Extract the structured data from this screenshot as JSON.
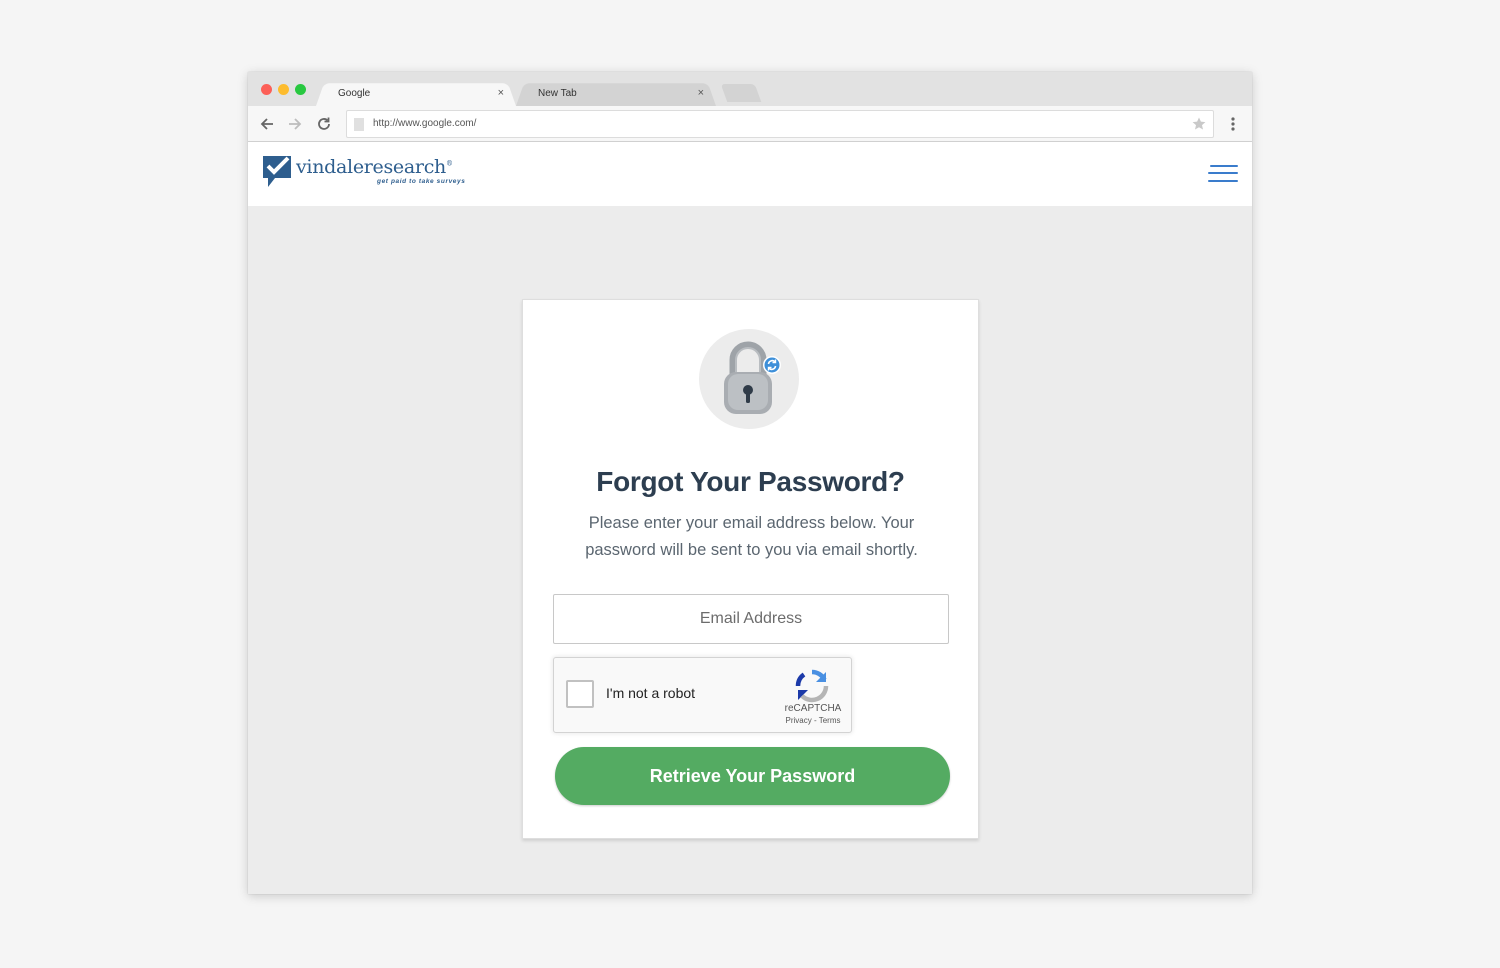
{
  "browser": {
    "tabs": [
      {
        "label": "Google",
        "close": "×"
      },
      {
        "label": "New Tab",
        "close": "×"
      }
    ],
    "url": "http://www.google.com/"
  },
  "site": {
    "logo_name": "vindaleresearch",
    "logo_registered": "®",
    "logo_tagline": "get paid to take surveys",
    "brand_color": "#2e5e8e",
    "menu_color": "#3a7ccc"
  },
  "form": {
    "title": "Forgot Your Password?",
    "description": "Please enter your email address below. Your password will be sent to you via email shortly.",
    "email_placeholder": "Email Address",
    "email_value": "",
    "recaptcha": {
      "label": "I'm not a robot",
      "brand": "reCAPTCHA",
      "links": "Privacy - Terms",
      "checked": false
    },
    "submit_label": "Retrieve Your Password",
    "submit_color": "#54ab62"
  },
  "icons": {
    "lock": "lock-reset-icon",
    "back": "arrow-left-icon",
    "forward": "arrow-right-icon",
    "reload": "reload-icon",
    "star": "star-icon",
    "more": "vertical-dots-icon",
    "menu": "hamburger-icon"
  }
}
